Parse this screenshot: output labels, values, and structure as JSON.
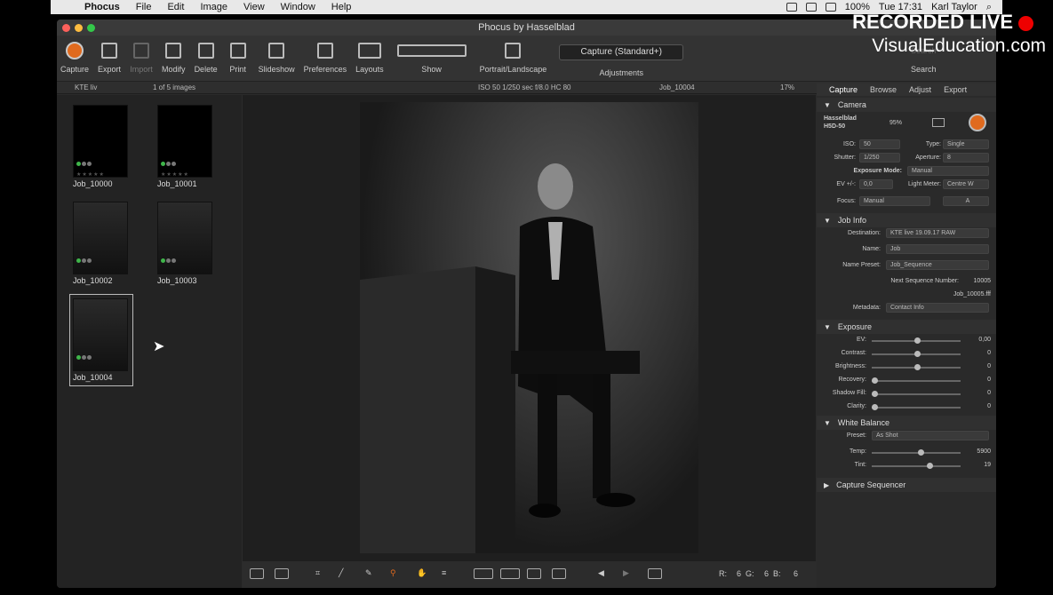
{
  "menubar": {
    "app": "Phocus",
    "items": [
      "File",
      "Edit",
      "Image",
      "View",
      "Window",
      "Help"
    ],
    "battery": "100%",
    "clock": "Tue 17:31",
    "user": "Karl Taylor"
  },
  "window": {
    "title": "Phocus by Hasselblad"
  },
  "toolbar": {
    "capture": "Capture",
    "export": "Export",
    "import": "Import",
    "modify": "Modify",
    "delete": "Delete",
    "print": "Print",
    "slideshow": "Slideshow",
    "preferences": "Preferences",
    "layouts": "Layouts",
    "show": "Show",
    "portrait": "Portrait/Landscape",
    "capture_select": "Capture (Standard+)",
    "adjustments": "Adjustments",
    "search": "Search",
    "search_placeholder": "Search"
  },
  "subbar": {
    "folder": "KTE liv",
    "count": "1 of 5 images",
    "exif": "ISO 50  1/250 sec  f/8.0  HC 80",
    "job": "Job_10004",
    "zoom": "17%"
  },
  "thumbs": [
    "Job_10000",
    "Job_10001",
    "Job_10002",
    "Job_10003",
    "Job_10004"
  ],
  "readout": {
    "r": "R:",
    "rv": "6",
    "g": "G:",
    "gv": "6",
    "b": "B:",
    "bv": "6"
  },
  "panel": {
    "tabs": [
      "Capture",
      "Browse",
      "Adjust",
      "Export"
    ],
    "camera": {
      "title": "Camera",
      "model1": "Hasselblad",
      "model2": "H5D-50",
      "battery": "95%",
      "iso_label": "ISO:",
      "iso": "50",
      "type_label": "Type:",
      "type": "Single",
      "shutter_label": "Shutter:",
      "shutter": "1/250",
      "aperture_label": "Aperture:",
      "aperture": "8",
      "mode_label": "Exposure Mode:",
      "mode": "Manual",
      "ev_label": "EV +/-:",
      "ev": "0,0",
      "meter_label": "Light Meter:",
      "meter": "Centre W",
      "focus_label": "Focus:",
      "focus": "Manual",
      "af": "A"
    },
    "job": {
      "title": "Job Info",
      "dest_label": "Destination:",
      "dest": "KTE live 19.09.17 RAW",
      "name_label": "Name:",
      "name": "Job",
      "preset_label": "Name Preset:",
      "preset": "Job_Sequence",
      "next_label": "Next Sequence Number:",
      "next": "10005",
      "file": "Job_10005.fff",
      "meta_label": "Metadata:",
      "meta": "Contact Info"
    },
    "exposure": {
      "title": "Exposure",
      "rows": [
        {
          "label": "EV:",
          "value": "0,00"
        },
        {
          "label": "Contrast:",
          "value": "0"
        },
        {
          "label": "Brightness:",
          "value": "0"
        },
        {
          "label": "Recovery:",
          "value": "0"
        },
        {
          "label": "Shadow Fill:",
          "value": "0"
        },
        {
          "label": "Clarity:",
          "value": "0"
        }
      ]
    },
    "wb": {
      "title": "White Balance",
      "preset_label": "Preset:",
      "preset": "As Shot",
      "temp_label": "Temp:",
      "temp": "5900",
      "tint_label": "Tint:",
      "tint": "19"
    },
    "sequencer": "Capture Sequencer"
  },
  "overlay": {
    "line1": "RECORDED LIVE",
    "line2": "VisualEducation.com"
  }
}
